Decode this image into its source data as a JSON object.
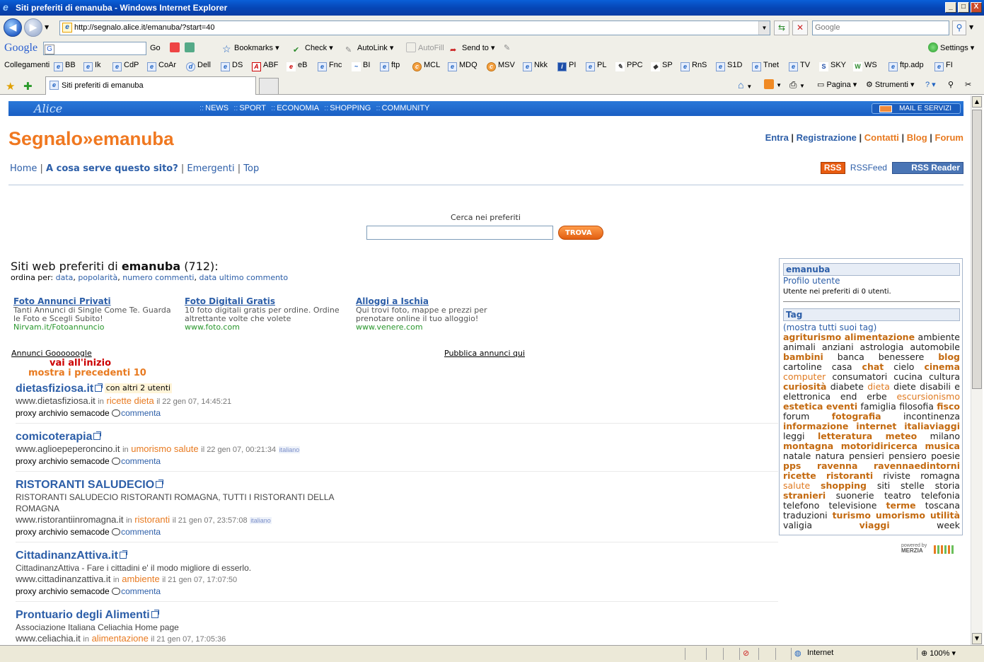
{
  "window": {
    "title": "Siti preferiti di emanuba - Windows Internet Explorer",
    "controls": [
      "_",
      "□",
      "X"
    ]
  },
  "address": {
    "url": "http://segnalo.alice.it/emanuba/?start=40",
    "search_placeholder": "Google"
  },
  "toolbar": {
    "google_label": "Google",
    "go": "Go",
    "bookmarks": "Bookmarks",
    "check": "Check",
    "autolink": "AutoLink",
    "autofill": "AutoFill",
    "sendto": "Send to",
    "settings": "Settings"
  },
  "links": {
    "label": "Collegamenti",
    "items": [
      "BB",
      "Ik",
      "CdP",
      "CoAr",
      "Dell",
      "DS",
      "ABF",
      "eB",
      "Fnc",
      "BI",
      "ftp",
      "MCL",
      "MDQ",
      "MSV",
      "Nkk",
      "PI",
      "PL",
      "PPC",
      "SP",
      "RnS",
      "S1D",
      "Tnet",
      "TV",
      "SKY",
      "WS",
      "ftp.adp",
      "FI"
    ]
  },
  "tabs": {
    "active": "Siti preferiti di emanuba"
  },
  "commandbar": {
    "pagina": "Pagina",
    "strumenti": "Strumenti"
  },
  "statusbar": {
    "zone": "Internet",
    "zoom": "100%"
  },
  "page": {
    "alice": {
      "logo": "Alice",
      "nav": [
        "NEWS",
        "SPORT",
        "ECONOMIA",
        "SHOPPING",
        "COMMUNITY"
      ],
      "mail": "MAIL E SERVIZI"
    },
    "brand": {
      "name": "Segnalo",
      "arrow": "»",
      "user": "emanuba"
    },
    "toplinks": [
      "Entra",
      "Registrazione",
      "Contatti",
      "Blog",
      "Forum"
    ],
    "mainnav": [
      "Home",
      "A cosa serve questo sito?",
      "Emergenti",
      "Top"
    ],
    "rss": {
      "badge": "RSS",
      "feed": "RSSFeed",
      "reader": "RSS Reader"
    },
    "search": {
      "label": "Cerca nei preferiti",
      "button": "TROVA"
    },
    "list": {
      "prefix": "Siti web preferiti di",
      "user": "emanuba",
      "count": "(712):",
      "sort_label": "ordina per:",
      "sort_options": [
        "data",
        "popolarità",
        "numero commenti",
        "data ultimo commento"
      ]
    },
    "ads": [
      {
        "title": "Foto Annunci Privati",
        "text": "Tanti Annunci di Single Come Te. Guarda le Foto e Scegli Subito!",
        "url": "Nirvam.it/Fotoannuncio"
      },
      {
        "title": "Foto Digitali Gratis",
        "text": "10 foto digitali gratis per ordine. Ordine altrettante volte che volete",
        "url": "www.foto.com"
      },
      {
        "title": "Alloggi a Ischia",
        "text": "Qui trovi foto, mappe e prezzi per prenotare online il tuo alloggio!",
        "url": "www.venere.com"
      }
    ],
    "ads_google": "Annunci Goooooogle",
    "ads_publish": "Pubblica annunci qui",
    "goto_start": "vai all'inizio",
    "show_prev": "mostra i precedenti 10",
    "entries": [
      {
        "title": "dietasfiziosa.it",
        "with": "con altri 2 utenti",
        "desc": "",
        "url": "www.dietasfiziosa.it",
        "in": "in",
        "tags": "ricette dieta",
        "date": "il 22 gen 07, 14:45:21",
        "lang": "",
        "actions": "proxy archivio semacode",
        "comment": "commenta"
      },
      {
        "title": "comicoterapia",
        "with": "",
        "desc": "",
        "url": "www.aglioepeperoncino.it",
        "in": "in",
        "tags": "umorismo salute",
        "date": "il 22 gen 07, 00:21:34",
        "lang": "italiano",
        "actions": "proxy archivio semacode",
        "comment": "commenta"
      },
      {
        "title": "RISTORANTI SALUDECIO",
        "with": "",
        "desc": "RISTORANTI SALUDECIO RISTORANTI ROMAGNA, TUTTI I RISTORANTI DELLA ROMAGNA",
        "url": "www.ristorantiinromagna.it",
        "in": "in",
        "tags": "ristoranti",
        "date": "il 21 gen 07, 23:57:08",
        "lang": "italiano",
        "actions": "proxy archivio semacode",
        "comment": "commenta"
      },
      {
        "title": "CittadinanzAttiva.it",
        "with": "",
        "desc": "CittadinanzAttiva - Fare i cittadini e' il modo migliore di esserlo.",
        "url": "www.cittadinanzattiva.it",
        "in": "in",
        "tags": "ambiente",
        "date": "il 21 gen 07, 17:07:50",
        "lang": "",
        "actions": "proxy archivio semacode",
        "comment": "commenta"
      },
      {
        "title": "Prontuario degli Alimenti",
        "with": "",
        "desc": "Associazione Italiana Celiachia Home page",
        "url": "www.celiachia.it",
        "in": "in",
        "tags": "alimentazione",
        "date": "il 21 gen 07, 17:05:36",
        "lang": "",
        "actions": "",
        "comment": ""
      }
    ],
    "sidebar": {
      "user": "emanuba",
      "profile": "Profilo utente",
      "count_text": "Utente nei preferiti di 0 utenti.",
      "tag_header": "Tag",
      "show_all": "(mostra tutti suoi tag)",
      "tags": [
        [
          "agriturismo",
          "h"
        ],
        [
          "alimentazione",
          "h"
        ],
        [
          "ambiente",
          ""
        ],
        [
          "animali",
          ""
        ],
        [
          "anziani",
          ""
        ],
        [
          "astrologia",
          ""
        ],
        [
          "automobile",
          ""
        ],
        [
          "bambini",
          "h"
        ],
        [
          "banca",
          ""
        ],
        [
          "benessere",
          ""
        ],
        [
          "blog",
          "h"
        ],
        [
          "cartoline",
          ""
        ],
        [
          "casa",
          ""
        ],
        [
          "chat",
          "h"
        ],
        [
          "cielo",
          ""
        ],
        [
          "cinema",
          "h"
        ],
        [
          "computer",
          "m"
        ],
        [
          "consumatori",
          ""
        ],
        [
          "cucina",
          ""
        ],
        [
          "cultura",
          ""
        ],
        [
          "curiosità",
          "h"
        ],
        [
          "diabete",
          ""
        ],
        [
          "dieta",
          "m"
        ],
        [
          "diete",
          ""
        ],
        [
          "disabili",
          ""
        ],
        [
          "e",
          ""
        ],
        [
          "elettronica",
          ""
        ],
        [
          "end",
          ""
        ],
        [
          "erbe",
          ""
        ],
        [
          "escursionismo",
          "m"
        ],
        [
          "estetica",
          "h"
        ],
        [
          "eventi",
          "h"
        ],
        [
          "famiglia",
          ""
        ],
        [
          "filosofia",
          ""
        ],
        [
          "fisco",
          "h"
        ],
        [
          "forum",
          ""
        ],
        [
          "fotografia",
          "h"
        ],
        [
          "incontinenza",
          ""
        ],
        [
          "informazione",
          "h"
        ],
        [
          "internet",
          "h"
        ],
        [
          "italiaviaggi",
          "h"
        ],
        [
          "leggi",
          ""
        ],
        [
          "letteratura",
          "h"
        ],
        [
          "meteo",
          "h"
        ],
        [
          "milano",
          ""
        ],
        [
          "montagna",
          "h"
        ],
        [
          "motoridiricerca",
          "h"
        ],
        [
          "musica",
          "h"
        ],
        [
          "natale",
          ""
        ],
        [
          "natura",
          ""
        ],
        [
          "pensieri",
          ""
        ],
        [
          "pensiero",
          ""
        ],
        [
          "poesie",
          ""
        ],
        [
          "pps",
          "h"
        ],
        [
          "ravenna",
          "h"
        ],
        [
          "ravennaedintorni",
          "h"
        ],
        [
          "ricette",
          "h"
        ],
        [
          "ristoranti",
          "h"
        ],
        [
          "riviste",
          ""
        ],
        [
          "romagna",
          ""
        ],
        [
          "salute",
          "m"
        ],
        [
          "shopping",
          "h"
        ],
        [
          "siti",
          ""
        ],
        [
          "stelle",
          ""
        ],
        [
          "storia",
          ""
        ],
        [
          "stranieri",
          "h"
        ],
        [
          "suonerie",
          ""
        ],
        [
          "teatro",
          ""
        ],
        [
          "telefonia",
          ""
        ],
        [
          "telefono",
          ""
        ],
        [
          "televisione",
          ""
        ],
        [
          "terme",
          "h"
        ],
        [
          "toscana",
          ""
        ],
        [
          "traduzioni",
          ""
        ],
        [
          "turismo",
          "h"
        ],
        [
          "umorismo",
          "h"
        ],
        [
          "utilità",
          "h"
        ],
        [
          "valigia",
          ""
        ],
        [
          "viaggi",
          "h"
        ],
        [
          "week",
          ""
        ]
      ]
    },
    "powered": {
      "line1": "powered by",
      "line2": "MERZIA"
    }
  }
}
